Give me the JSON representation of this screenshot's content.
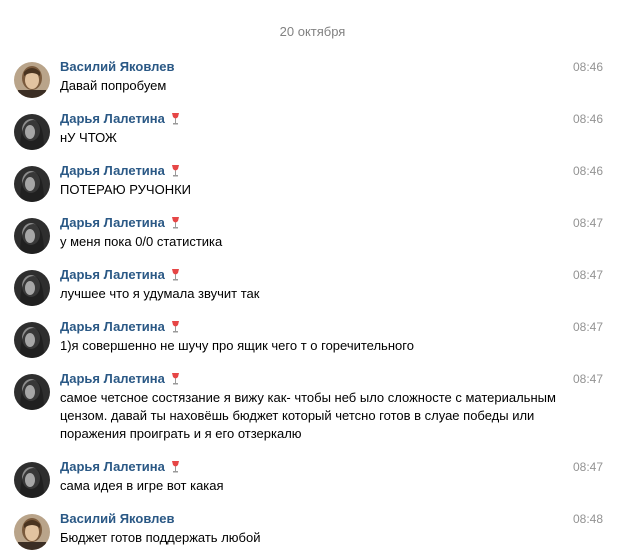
{
  "date_separator": "20 октября",
  "messages": [
    {
      "author": "Василий Яковлев",
      "time": "08:46",
      "text": "Давай попробуем",
      "avatar": "vasily",
      "badge_icon": ""
    },
    {
      "author": "Дарья Лалетина",
      "time": "08:46",
      "text": "нУ ЧТОЖ",
      "avatar": "darya",
      "badge_icon": "wine-glass-icon"
    },
    {
      "author": "Дарья Лалетина",
      "time": "08:46",
      "text": "ПОТЕРАЮ РУЧОНКИ",
      "avatar": "darya",
      "badge_icon": "wine-glass-icon"
    },
    {
      "author": "Дарья Лалетина",
      "time": "08:47",
      "text": "у меня пока 0/0 статистика",
      "avatar": "darya",
      "badge_icon": "wine-glass-icon"
    },
    {
      "author": "Дарья Лалетина",
      "time": "08:47",
      "text": "лучшее что я удумала звучит так",
      "avatar": "darya",
      "badge_icon": "wine-glass-icon"
    },
    {
      "author": "Дарья Лалетина",
      "time": "08:47",
      "text": "1)я совершенно не шучу про ящик чего т о горечительного",
      "avatar": "darya",
      "badge_icon": "wine-glass-icon"
    },
    {
      "author": "Дарья Лалетина",
      "time": "08:47",
      "text": "самое четсное состязание я вижу как- чтобы неб ыло сложносте с материальным цензом. давай ты наховёшь бюджет который четсно готов в слуае победы или поражения проиграть и я его отзеркалю",
      "avatar": "darya",
      "badge_icon": "wine-glass-icon"
    },
    {
      "author": "Дарья Лалетина",
      "time": "08:47",
      "text": "сама идея в игре вот какая",
      "avatar": "darya",
      "badge_icon": "wine-glass-icon"
    },
    {
      "author": "Василий Яковлев",
      "time": "08:48",
      "text": "Бюджет готов поддержать любой",
      "avatar": "vasily",
      "badge_icon": ""
    }
  ],
  "colors": {
    "author_name": "#2a5885",
    "time": "#939393",
    "date_separator": "#828282",
    "wine_glass": "#e64646"
  }
}
